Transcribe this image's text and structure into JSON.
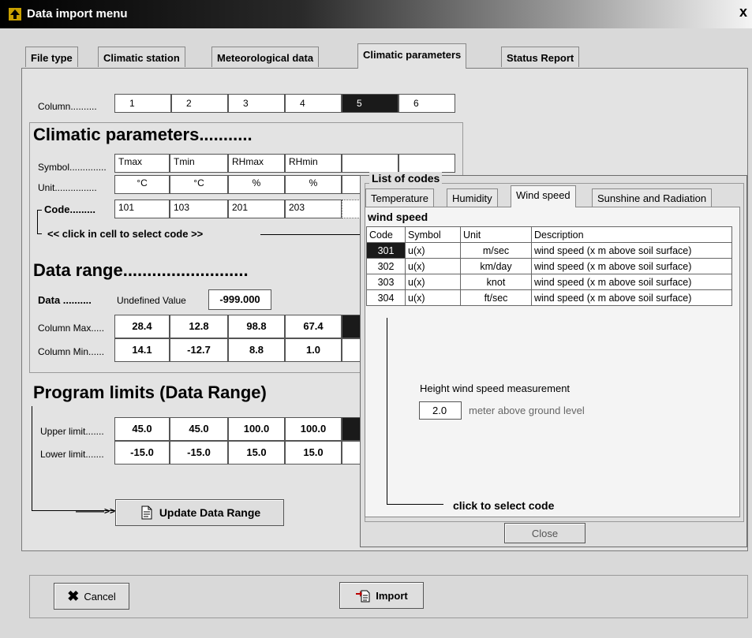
{
  "window": {
    "title": "Data import menu",
    "close_glyph": "x",
    "icon": "upload-arrow-icon"
  },
  "tabs": [
    {
      "label": "File type",
      "active": false
    },
    {
      "label": "Climatic station",
      "active": false
    },
    {
      "label": "Meteorological data",
      "active": false
    },
    {
      "label": "Climatic parameters",
      "active": true
    },
    {
      "label": "Status Report",
      "active": false
    }
  ],
  "columns": {
    "label": "Column..........",
    "numbers": [
      "1",
      "2",
      "3",
      "4",
      "5",
      "6"
    ],
    "selected": "5"
  },
  "climatic_parameters": {
    "heading": "Climatic parameters...........",
    "symbol_label": "Symbol..............",
    "unit_label": "Unit................",
    "code_label": "Code.........",
    "symbols": [
      "Tmax",
      "Tmin",
      "RHmax",
      "RHmin",
      "",
      ""
    ],
    "units": [
      "°C",
      "°C",
      "%",
      "%",
      "",
      ""
    ],
    "codes": [
      "101",
      "103",
      "201",
      "203",
      "",
      ""
    ],
    "hint": "<< click in cell to select code >>"
  },
  "data_range": {
    "heading": "Data range..........................",
    "data_label": "Data ..........",
    "undefined_label": "Undefined Value",
    "undefined_value": "-999.000",
    "max_label": "Column Max.....",
    "min_label": "Column Min......",
    "max": [
      "28.4",
      "12.8",
      "98.8",
      "67.4"
    ],
    "min": [
      "14.1",
      "-12.7",
      "8.8",
      "1.0"
    ]
  },
  "program_limits": {
    "heading": "Program limits (Data Range)",
    "upper_label": "Upper limit.......",
    "lower_label": "Lower limit.......",
    "upper": [
      "45.0",
      "45.0",
      "100.0",
      "100.0"
    ],
    "lower": [
      "-15.0",
      "-15.0",
      "15.0",
      "15.0"
    ],
    "arrow": "———>>>",
    "update_button": "Update Data Range"
  },
  "list_of_codes": {
    "title": "List of codes",
    "tabs": [
      {
        "label": "Temperature",
        "active": false
      },
      {
        "label": "Humidity",
        "active": false
      },
      {
        "label": "Wind speed",
        "active": true
      },
      {
        "label": "Sunshine and Radiation",
        "active": false
      }
    ],
    "section": "wind speed",
    "headers": [
      "Code",
      "Symbol",
      "Unit",
      "Description"
    ],
    "rows": [
      {
        "code": "301",
        "symbol": "u(x)",
        "unit": "m/sec",
        "description": "wind speed (x m above soil surface)",
        "selected": true
      },
      {
        "code": "302",
        "symbol": "u(x)",
        "unit": "km/day",
        "description": "wind speed (x m above soil surface)",
        "selected": false
      },
      {
        "code": "303",
        "symbol": "u(x)",
        "unit": "knot",
        "description": "wind speed (x m above soil surface)",
        "selected": false
      },
      {
        "code": "304",
        "symbol": "u(x)",
        "unit": "ft/sec",
        "description": "wind speed (x m above soil surface)",
        "selected": false
      }
    ],
    "height_label": "Height wind speed measurement",
    "height_value": "2.0",
    "height_unit": "meter above ground level",
    "select_hint": "click to select code",
    "close_button": "Close"
  },
  "footer": {
    "cancel": "Cancel",
    "import": "Import"
  }
}
